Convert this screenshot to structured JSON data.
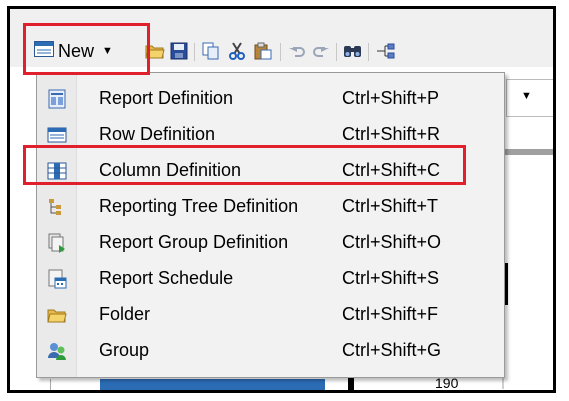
{
  "toolbar": {
    "new_label": "New",
    "buttons": [
      "open-folder-icon",
      "save-icon",
      "copy-icon",
      "cut-icon",
      "paste-icon",
      "undo-icon",
      "redo-icon",
      "find-icon",
      "tree-icon"
    ]
  },
  "menu": {
    "items": [
      {
        "label": "Report Definition",
        "shortcut": "Ctrl+Shift+P",
        "icon": "report-definition-icon"
      },
      {
        "label": "Row Definition",
        "shortcut": "Ctrl+Shift+R",
        "icon": "row-definition-icon"
      },
      {
        "label": "Column Definition",
        "shortcut": "Ctrl+Shift+C",
        "icon": "column-definition-icon",
        "highlighted": true
      },
      {
        "label": "Reporting Tree Definition",
        "shortcut": "Ctrl+Shift+T",
        "icon": "reporting-tree-icon"
      },
      {
        "label": "Report Group Definition",
        "shortcut": "Ctrl+Shift+O",
        "icon": "report-group-icon"
      },
      {
        "label": "Report Schedule",
        "shortcut": "Ctrl+Shift+S",
        "icon": "report-schedule-icon"
      },
      {
        "label": "Folder",
        "shortcut": "Ctrl+Shift+F",
        "icon": "folder-icon"
      },
      {
        "label": "Group",
        "shortcut": "Ctrl+Shift+G",
        "icon": "group-icon"
      }
    ]
  },
  "background": {
    "row_number": "190"
  },
  "colors": {
    "highlight_border": "#e0202c"
  }
}
